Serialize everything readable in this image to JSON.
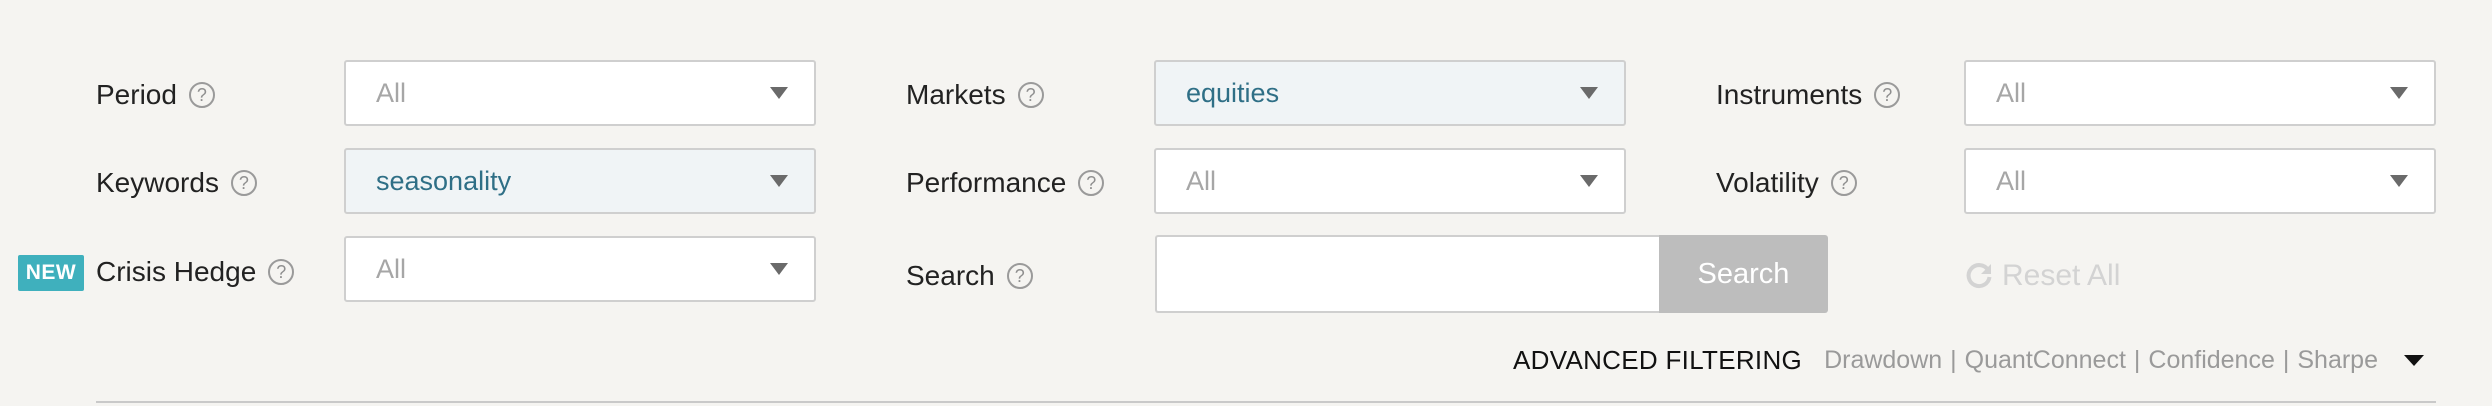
{
  "filters": {
    "period": {
      "label": "Period",
      "value": "All"
    },
    "keywords": {
      "label": "Keywords",
      "value": "seasonality"
    },
    "crisis_hedge": {
      "label": "Crisis Hedge",
      "value": "All",
      "badge": "NEW"
    },
    "markets": {
      "label": "Markets",
      "value": "equities"
    },
    "performance": {
      "label": "Performance",
      "value": "All"
    },
    "instruments": {
      "label": "Instruments",
      "value": "All"
    },
    "volatility": {
      "label": "Volatility",
      "value": "All"
    }
  },
  "search": {
    "label": "Search",
    "value": "",
    "placeholder": "",
    "button_label": "Search"
  },
  "reset": {
    "label": "Reset All"
  },
  "help_glyph": "?",
  "advanced": {
    "title": "ADVANCED FILTERING",
    "items": [
      "Drawdown",
      "QuantConnect",
      "Confidence",
      "Sharpe"
    ],
    "separator": "|"
  },
  "colors": {
    "background": "#f5f4f1",
    "badge": "#3fb0bd",
    "active_select_text": "#2f6f86",
    "active_select_bg": "#f0f4f6",
    "search_button": "#bdbdbd"
  },
  "icons": {
    "help": "question-circle-icon",
    "dropdown": "caret-down-icon",
    "reset": "refresh-icon"
  }
}
